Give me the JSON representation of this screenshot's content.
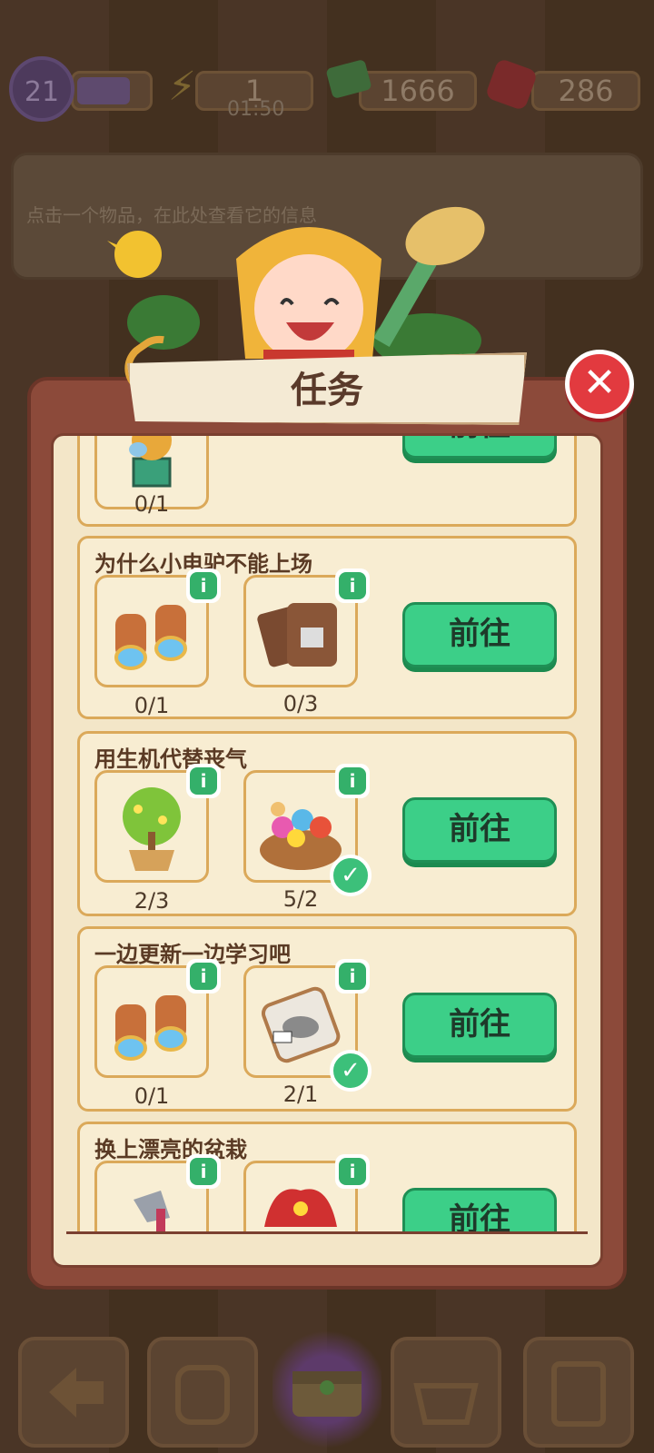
{
  "hud": {
    "level": "21",
    "energy": "1",
    "timer": "01:50",
    "cash": "1666",
    "gems": "286"
  },
  "info_panel": {
    "hint": "点击一个物品，在此处查看它的信息"
  },
  "dialog": {
    "title": "任务",
    "close_icon": "close-x"
  },
  "tasks": [
    {
      "title": "",
      "items": [
        {
          "icon": "statue-icon",
          "count": "0/1",
          "done": false
        }
      ],
      "button": "前往"
    },
    {
      "title": "为什么小电驴不能上场",
      "items": [
        {
          "icon": "binoculars-icon",
          "count": "0/1",
          "done": false
        },
        {
          "icon": "leather-pouch-icon",
          "count": "0/3",
          "done": false
        }
      ],
      "button": "前往"
    },
    {
      "title": "用生机代替丧气",
      "items": [
        {
          "icon": "potted-tree-icon",
          "count": "2/3",
          "done": false
        },
        {
          "icon": "flower-basket-icon",
          "count": "5/2",
          "done": true
        }
      ],
      "button": "前往"
    },
    {
      "title": "一边更新一边学习吧",
      "items": [
        {
          "icon": "binoculars-icon",
          "count": "0/1",
          "done": false
        },
        {
          "icon": "bag-icon",
          "count": "2/1",
          "done": true
        }
      ],
      "button": "前往"
    },
    {
      "title": "换上漂亮的盆栽",
      "items": [
        {
          "icon": "hatchet-icon",
          "count": "",
          "done": false
        },
        {
          "icon": "red-plant-icon",
          "count": "",
          "done": false
        }
      ],
      "button": "前往"
    }
  ],
  "info_badge": "i",
  "check_glyph": "✓",
  "colors": {
    "go_button": "#3ccf88",
    "close_button": "#e23a3f",
    "dialog_frame": "#8c4a3a"
  }
}
